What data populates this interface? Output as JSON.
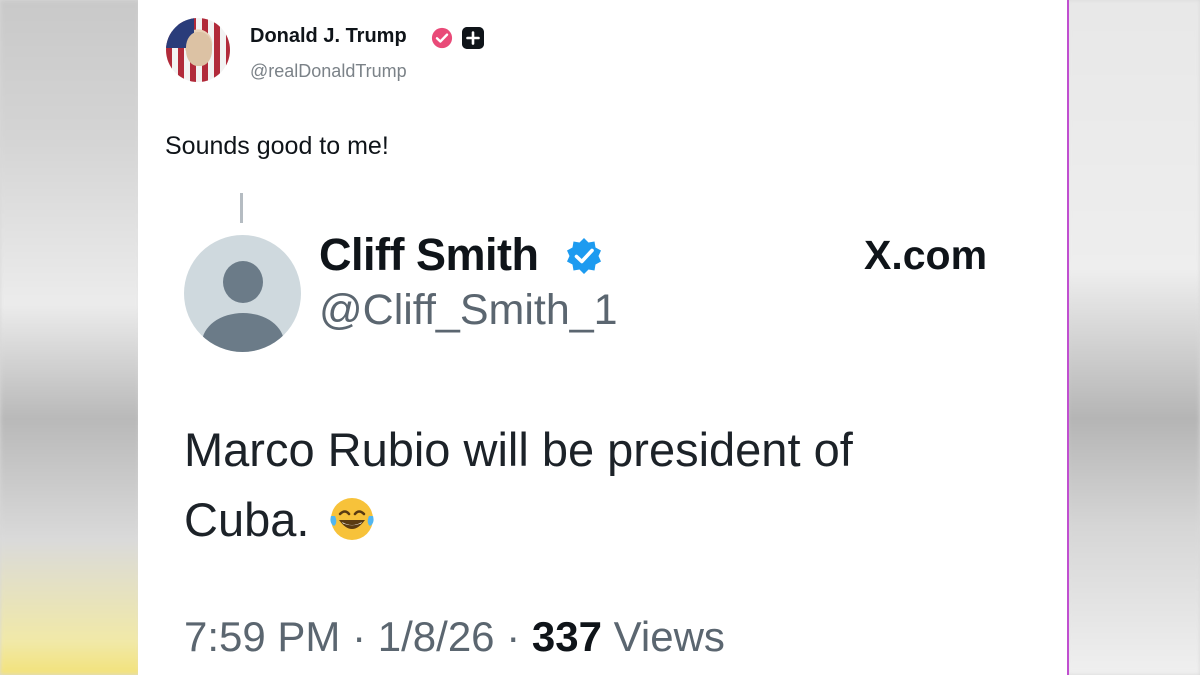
{
  "colors": {
    "verified_pink": "#e94a78",
    "verified_blue": "#1d9bf0",
    "text_primary": "#0f1419",
    "text_secondary": "#5b6670",
    "frame_accent": "#c04fd0"
  },
  "post": {
    "author": {
      "name": "Donald J. Trump",
      "handle": "@realDonaldTrump",
      "badges": [
        "verified-badge-icon",
        "plus-badge-icon"
      ]
    },
    "text": "Sounds good to me!"
  },
  "quoted": {
    "author": {
      "name": "Cliff Smith",
      "handle": "@Cliff_Smith_1",
      "badge": "verified-badge-icon"
    },
    "source": "X.com",
    "text_line1": "Marco Rubio will be president of",
    "text_line2": "Cuba.",
    "emoji": "face-with-tears-of-joy-icon",
    "time": "7:59 PM",
    "date": "1/8/26",
    "views_count": "337",
    "views_label": "Views",
    "separator": "·"
  }
}
